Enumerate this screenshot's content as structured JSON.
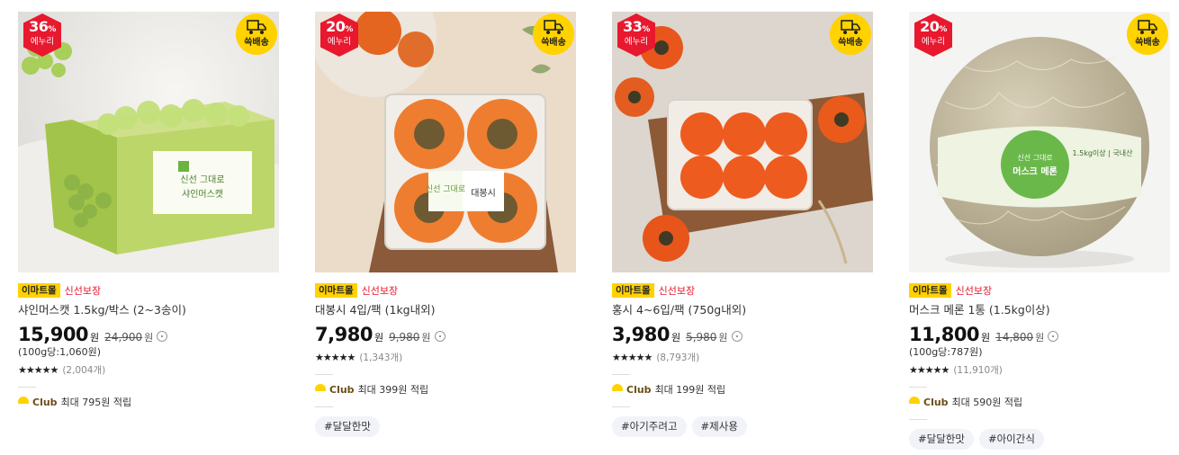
{
  "products": [
    {
      "discount": "36",
      "discount_unit": "%",
      "discount_label": "에누리",
      "ship_label": "쓱배송",
      "mall_tag": "이마트몰",
      "fresh_tag": "신선보장",
      "name": "샤인머스캣 1.5kg/박스 (2~3송이)",
      "price": "15,900",
      "price_unit": "원",
      "original_price": "24,900",
      "original_unit": "원",
      "unit_price": "(100g당:1,060원)",
      "stars": "★★★★★",
      "rating": 4.5,
      "reviews": "(2,004개)",
      "club_label": "Club",
      "club_text": "최대 795원 적립",
      "hashtags": []
    },
    {
      "discount": "20",
      "discount_unit": "%",
      "discount_label": "에누리",
      "ship_label": "쓱배송",
      "mall_tag": "이마트몰",
      "fresh_tag": "신선보장",
      "name": "대봉시 4입/팩 (1kg내외)",
      "price": "7,980",
      "price_unit": "원",
      "original_price": "9,980",
      "original_unit": "원",
      "unit_price": "",
      "stars": "★★★★★",
      "rating": 5,
      "reviews": "(1,343개)",
      "club_label": "Club",
      "club_text": "최대 399원 적립",
      "hashtags": [
        "#달달한맛"
      ]
    },
    {
      "discount": "33",
      "discount_unit": "%",
      "discount_label": "에누리",
      "ship_label": "쓱배송",
      "mall_tag": "이마트몰",
      "fresh_tag": "신선보장",
      "name": "홍시 4~6입/팩 (750g내외)",
      "price": "3,980",
      "price_unit": "원",
      "original_price": "5,980",
      "original_unit": "원",
      "unit_price": "",
      "stars": "★★★★★",
      "rating": 4.5,
      "reviews": "(8,793개)",
      "club_label": "Club",
      "club_text": "최대 199원 적립",
      "hashtags": [
        "#아기주려고",
        "#제사용"
      ]
    },
    {
      "discount": "20",
      "discount_unit": "%",
      "discount_label": "에누리",
      "ship_label": "쓱배송",
      "mall_tag": "이마트몰",
      "fresh_tag": "신선보장",
      "name": "머스크 메론 1통 (1.5kg이상)",
      "price": "11,800",
      "price_unit": "원",
      "original_price": "14,800",
      "original_unit": "원",
      "unit_price": "(100g당:787원)",
      "stars": "★★★★★",
      "rating": 4.5,
      "reviews": "(11,910개)",
      "club_label": "Club",
      "club_text": "최대 590원 적립",
      "hashtags": [
        "#달달한맛",
        "#아이간식"
      ]
    }
  ],
  "image_text": {
    "grape_box_brand": "신선 그대로",
    "grape_box_name": "샤인머스캣",
    "persimmon_brand": "신선 그대로",
    "persimmon_name": "대봉시",
    "melon_brand": "신선 그대로",
    "melon_name": "머스크 메론",
    "melon_weight": "1.5kg이상 | 국내산"
  }
}
